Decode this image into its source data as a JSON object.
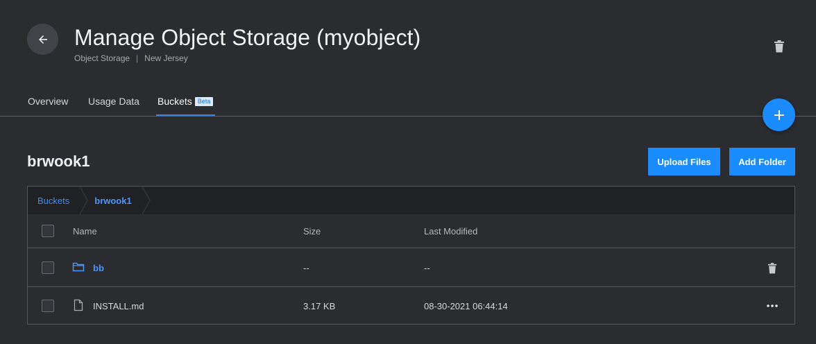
{
  "header": {
    "title": "Manage Object Storage (myobject)",
    "breadcrumb_service": "Object Storage",
    "breadcrumb_separator": "|",
    "breadcrumb_region": "New Jersey"
  },
  "tabs": [
    {
      "label": "Overview"
    },
    {
      "label": "Usage Data"
    },
    {
      "label": "Buckets",
      "badge": "Beta",
      "active": true
    }
  ],
  "bucket": {
    "name": "brwook1",
    "upload_label": "Upload Files",
    "add_folder_label": "Add Folder"
  },
  "breadcrumb": {
    "root": "Buckets",
    "current": "brwook1"
  },
  "table": {
    "columns": [
      "Name",
      "Size",
      "Last Modified"
    ],
    "rows": [
      {
        "type": "folder",
        "name": "bb",
        "size": "--",
        "modified": "--"
      },
      {
        "type": "file",
        "name": "INSTALL.md",
        "size": "3.17 KB",
        "modified": "08-30-2021 06:44:14"
      }
    ]
  },
  "colors": {
    "accent": "#1a8cff",
    "link": "#4a95ff",
    "background": "#2b2c30"
  }
}
